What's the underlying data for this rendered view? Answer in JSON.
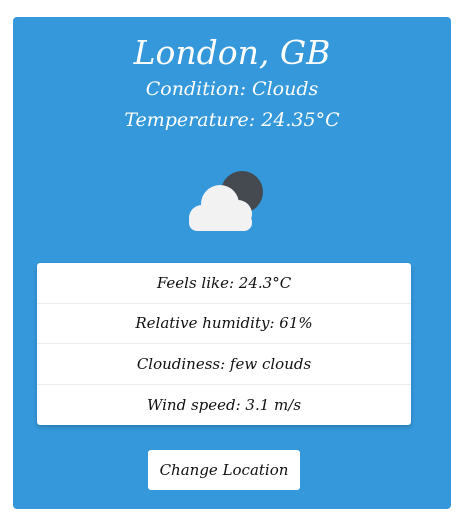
{
  "location": {
    "city": "London, GB",
    "condition": "Condition: Clouds",
    "temperature": "Temperature: 24.35°C"
  },
  "icon": "cloud-with-dark-moon-icon",
  "details": [
    "Feels like: 24.3°C",
    "Relative humidity: 61%",
    "Cloudiness: few clouds",
    "Wind speed: 3.1 m/s"
  ],
  "button": {
    "label": "Change Location"
  },
  "colors": {
    "card_background": "#3498db",
    "text_on_card": "#ffffff",
    "panel_background": "#ffffff"
  }
}
